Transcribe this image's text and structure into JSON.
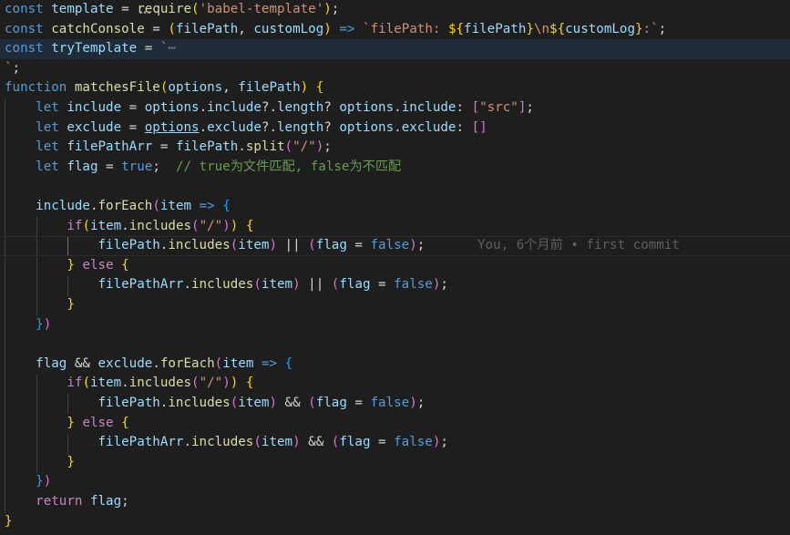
{
  "editor": {
    "current_line": 3,
    "cursor_line": 13,
    "blame": {
      "line": 13,
      "text": "You, 6个月前 • first commit"
    },
    "colors": {
      "background": "#1e1e1e",
      "keyword": "#569cd6",
      "variable": "#9cdcfe",
      "function": "#dcdcaa",
      "string": "#ce9178",
      "comment": "#6a9955",
      "control": "#c586c0",
      "bracket1": "#ffd700",
      "bracket2": "#da70d6",
      "bracket3": "#179fff"
    },
    "lines": [
      [
        [
          "const",
          "k"
        ],
        [
          " ",
          "p"
        ],
        [
          "template",
          "v"
        ],
        [
          " = ",
          "p"
        ],
        [
          "require",
          "f"
        ],
        [
          "(",
          "b1"
        ],
        [
          "'babel-template'",
          "s"
        ],
        [
          ")",
          "b1"
        ],
        [
          ";",
          "p"
        ]
      ],
      [
        [
          "const",
          "k"
        ],
        [
          " ",
          "p"
        ],
        [
          "catchConsole",
          "f"
        ],
        [
          " = ",
          "p"
        ],
        [
          "(",
          "b1"
        ],
        [
          "filePath",
          "v"
        ],
        [
          ", ",
          "p"
        ],
        [
          "customLog",
          "v"
        ],
        [
          ")",
          "b1"
        ],
        [
          " ",
          "p"
        ],
        [
          "=>",
          "k"
        ],
        [
          " ",
          "p"
        ],
        [
          "`filePath: ",
          "s"
        ],
        [
          "${",
          "b1"
        ],
        [
          "filePath",
          "v"
        ],
        [
          "}",
          "b1"
        ],
        [
          "\\n",
          "s"
        ],
        [
          "${",
          "b1"
        ],
        [
          "customLog",
          "v"
        ],
        [
          "}",
          "b1"
        ],
        [
          ":`",
          "s"
        ],
        [
          ";",
          "p"
        ]
      ],
      [
        [
          "const",
          "k"
        ],
        [
          " ",
          "p"
        ],
        [
          "tryTemplate",
          "v"
        ],
        [
          " = ",
          "p"
        ],
        [
          "`",
          "s"
        ],
        [
          "⋯",
          "fold"
        ]
      ],
      [
        [
          "`",
          "s"
        ],
        [
          ";",
          "p"
        ]
      ],
      [
        [
          "function",
          "k"
        ],
        [
          " ",
          "p"
        ],
        [
          "matchesFile",
          "f"
        ],
        [
          "(",
          "b1"
        ],
        [
          "options",
          "v"
        ],
        [
          ", ",
          "p"
        ],
        [
          "filePath",
          "v"
        ],
        [
          ")",
          "b1"
        ],
        [
          " ",
          "p"
        ],
        [
          "{",
          "b1"
        ]
      ],
      [
        [
          "    ",
          "p"
        ],
        [
          "let",
          "k"
        ],
        [
          " ",
          "p"
        ],
        [
          "include",
          "v"
        ],
        [
          " = ",
          "p"
        ],
        [
          "options",
          "v"
        ],
        [
          ".",
          "p"
        ],
        [
          "include",
          "v"
        ],
        [
          "?.",
          "p"
        ],
        [
          "length",
          "v"
        ],
        [
          "? ",
          "p"
        ],
        [
          "options",
          "v"
        ],
        [
          ".",
          "p"
        ],
        [
          "include",
          "v"
        ],
        [
          ": ",
          "p"
        ],
        [
          "[",
          "b2"
        ],
        [
          "\"src\"",
          "s"
        ],
        [
          "]",
          "b2"
        ],
        [
          ";",
          "p"
        ]
      ],
      [
        [
          "    ",
          "p"
        ],
        [
          "let",
          "k"
        ],
        [
          " ",
          "p"
        ],
        [
          "exclude",
          "v"
        ],
        [
          " = ",
          "p"
        ],
        [
          "options",
          "u"
        ],
        [
          ".",
          "p"
        ],
        [
          "exclude",
          "v"
        ],
        [
          "?.",
          "p"
        ],
        [
          "length",
          "v"
        ],
        [
          "? ",
          "p"
        ],
        [
          "options",
          "v"
        ],
        [
          ".",
          "p"
        ],
        [
          "exclude",
          "v"
        ],
        [
          ": ",
          "p"
        ],
        [
          "[]",
          "b2"
        ]
      ],
      [
        [
          "    ",
          "p"
        ],
        [
          "let",
          "k"
        ],
        [
          " ",
          "p"
        ],
        [
          "filePathArr",
          "v"
        ],
        [
          " = ",
          "p"
        ],
        [
          "filePath",
          "v"
        ],
        [
          ".",
          "p"
        ],
        [
          "split",
          "f"
        ],
        [
          "(",
          "b2"
        ],
        [
          "\"/\"",
          "s"
        ],
        [
          ")",
          "b2"
        ],
        [
          ";",
          "p"
        ]
      ],
      [
        [
          "    ",
          "p"
        ],
        [
          "let",
          "k"
        ],
        [
          " ",
          "p"
        ],
        [
          "flag",
          "v"
        ],
        [
          " = ",
          "p"
        ],
        [
          "true",
          "k"
        ],
        [
          ";  ",
          "p"
        ],
        [
          "// true为文件匹配, false为不匹配",
          "c"
        ]
      ],
      [],
      [
        [
          "    ",
          "p"
        ],
        [
          "include",
          "v"
        ],
        [
          ".",
          "p"
        ],
        [
          "forEach",
          "f"
        ],
        [
          "(",
          "b2"
        ],
        [
          "item",
          "v"
        ],
        [
          " ",
          "p"
        ],
        [
          "=>",
          "k"
        ],
        [
          " ",
          "p"
        ],
        [
          "{",
          "b3"
        ]
      ],
      [
        [
          "        ",
          "p"
        ],
        [
          "if",
          "kw"
        ],
        [
          "(",
          "b1"
        ],
        [
          "item",
          "v"
        ],
        [
          ".",
          "p"
        ],
        [
          "includes",
          "f"
        ],
        [
          "(",
          "b2"
        ],
        [
          "\"/\"",
          "s"
        ],
        [
          ")",
          "b2"
        ],
        [
          ")",
          "b1"
        ],
        [
          " ",
          "p"
        ],
        [
          "{",
          "b1"
        ]
      ],
      [
        [
          "            ",
          "p"
        ],
        [
          "filePath",
          "v"
        ],
        [
          ".",
          "p"
        ],
        [
          "includes",
          "f"
        ],
        [
          "(",
          "b2"
        ],
        [
          "item",
          "v"
        ],
        [
          ")",
          "b2"
        ],
        [
          " || ",
          "p"
        ],
        [
          "(",
          "b2"
        ],
        [
          "flag",
          "v"
        ],
        [
          " = ",
          "p"
        ],
        [
          "false",
          "k"
        ],
        [
          ")",
          "b2"
        ],
        [
          ";",
          "p"
        ]
      ],
      [
        [
          "        ",
          "p"
        ],
        [
          "}",
          "b1"
        ],
        [
          " ",
          "p"
        ],
        [
          "else",
          "kw"
        ],
        [
          " ",
          "p"
        ],
        [
          "{",
          "b1"
        ]
      ],
      [
        [
          "            ",
          "p"
        ],
        [
          "filePathArr",
          "v"
        ],
        [
          ".",
          "p"
        ],
        [
          "includes",
          "f"
        ],
        [
          "(",
          "b2"
        ],
        [
          "item",
          "v"
        ],
        [
          ")",
          "b2"
        ],
        [
          " || ",
          "p"
        ],
        [
          "(",
          "b2"
        ],
        [
          "flag",
          "v"
        ],
        [
          " = ",
          "p"
        ],
        [
          "false",
          "k"
        ],
        [
          ")",
          "b2"
        ],
        [
          ";",
          "p"
        ]
      ],
      [
        [
          "        ",
          "p"
        ],
        [
          "}",
          "b1"
        ]
      ],
      [
        [
          "    ",
          "p"
        ],
        [
          "}",
          "b3"
        ],
        [
          ")",
          "b2"
        ]
      ],
      [],
      [
        [
          "    ",
          "p"
        ],
        [
          "flag",
          "v"
        ],
        [
          " && ",
          "p"
        ],
        [
          "exclude",
          "v"
        ],
        [
          ".",
          "p"
        ],
        [
          "forEach",
          "f"
        ],
        [
          "(",
          "b2"
        ],
        [
          "item",
          "v"
        ],
        [
          " ",
          "p"
        ],
        [
          "=>",
          "k"
        ],
        [
          " ",
          "p"
        ],
        [
          "{",
          "b3"
        ]
      ],
      [
        [
          "        ",
          "p"
        ],
        [
          "if",
          "kw"
        ],
        [
          "(",
          "b1"
        ],
        [
          "item",
          "v"
        ],
        [
          ".",
          "p"
        ],
        [
          "includes",
          "f"
        ],
        [
          "(",
          "b2"
        ],
        [
          "\"/\"",
          "s"
        ],
        [
          ")",
          "b2"
        ],
        [
          ")",
          "b1"
        ],
        [
          " ",
          "p"
        ],
        [
          "{",
          "b1"
        ]
      ],
      [
        [
          "            ",
          "p"
        ],
        [
          "filePath",
          "v"
        ],
        [
          ".",
          "p"
        ],
        [
          "includes",
          "f"
        ],
        [
          "(",
          "b2"
        ],
        [
          "item",
          "v"
        ],
        [
          ")",
          "b2"
        ],
        [
          " && ",
          "p"
        ],
        [
          "(",
          "b2"
        ],
        [
          "flag",
          "v"
        ],
        [
          " = ",
          "p"
        ],
        [
          "false",
          "k"
        ],
        [
          ")",
          "b2"
        ],
        [
          ";",
          "p"
        ]
      ],
      [
        [
          "        ",
          "p"
        ],
        [
          "}",
          "b1"
        ],
        [
          " ",
          "p"
        ],
        [
          "else",
          "kw"
        ],
        [
          " ",
          "p"
        ],
        [
          "{",
          "b1"
        ]
      ],
      [
        [
          "            ",
          "p"
        ],
        [
          "filePathArr",
          "v"
        ],
        [
          ".",
          "p"
        ],
        [
          "includes",
          "f"
        ],
        [
          "(",
          "b2"
        ],
        [
          "item",
          "v"
        ],
        [
          ")",
          "b2"
        ],
        [
          " && ",
          "p"
        ],
        [
          "(",
          "b2"
        ],
        [
          "flag",
          "v"
        ],
        [
          " = ",
          "p"
        ],
        [
          "false",
          "k"
        ],
        [
          ")",
          "b2"
        ],
        [
          ";",
          "p"
        ]
      ],
      [
        [
          "        ",
          "p"
        ],
        [
          "}",
          "b1"
        ]
      ],
      [
        [
          "    ",
          "p"
        ],
        [
          "}",
          "b3"
        ],
        [
          ")",
          "b2"
        ]
      ],
      [
        [
          "    ",
          "p"
        ],
        [
          "return",
          "kw"
        ],
        [
          " ",
          "p"
        ],
        [
          "flag",
          "v"
        ],
        [
          ";",
          "p"
        ]
      ],
      [
        [
          "}",
          "b1"
        ]
      ]
    ]
  }
}
